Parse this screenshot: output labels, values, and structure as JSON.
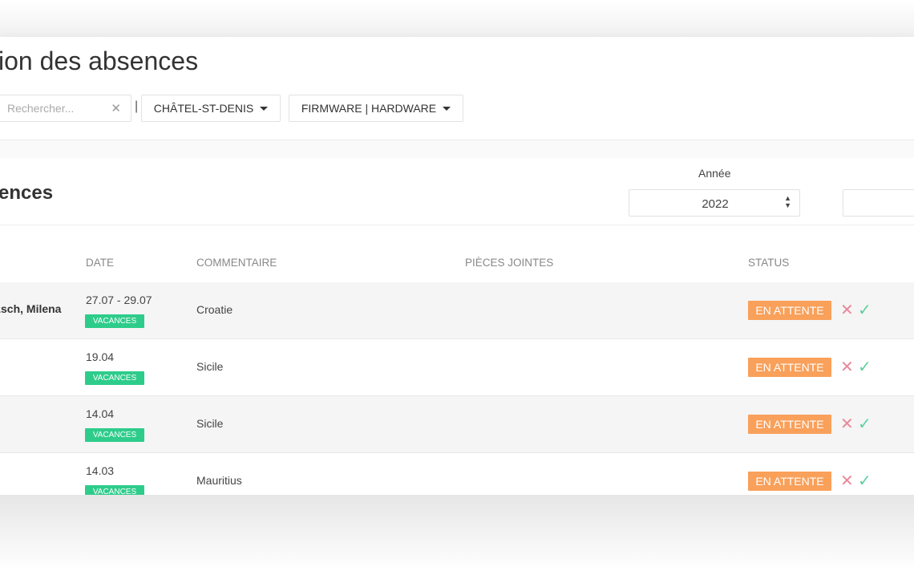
{
  "header": {
    "title": "ion des absences"
  },
  "toolbar": {
    "search_placeholder": "Rechercher...",
    "clear_icon": "close-icon",
    "separator": "|",
    "location_filter": "CHÂTEL-ST-DENIS",
    "department_filter": "FIRMWARE | HARDWARE"
  },
  "section": {
    "title": "ences",
    "year_label": "Année",
    "year_value": "2022"
  },
  "table": {
    "columns": {
      "date": "DATE",
      "comment": "COMMENTAIRE",
      "attachments": "PIÈCES JOINTES",
      "status": "STATUS"
    },
    "rows": [
      {
        "name": "zsch, Milena",
        "date": "27.07 - 29.07",
        "type": "VACANCES",
        "comment": "Croatie",
        "status": "EN ATTENTE"
      },
      {
        "name": "",
        "date": "19.04",
        "type": "VACANCES",
        "comment": "Sicile",
        "status": "EN ATTENTE"
      },
      {
        "name": "",
        "date": "14.04",
        "type": "VACANCES",
        "comment": "Sicile",
        "status": "EN ATTENTE"
      },
      {
        "name": "",
        "date": "14.03",
        "type": "VACANCES",
        "comment": "Mauritius",
        "status": "EN ATTENTE"
      }
    ]
  },
  "icons": {
    "reject": "close-icon",
    "approve": "check-icon"
  },
  "colors": {
    "vacances_badge": "#2ecc8b",
    "status_pending": "#f9a05a",
    "reject_icon": "#e8889a",
    "approve_icon": "#5fcfa0"
  }
}
